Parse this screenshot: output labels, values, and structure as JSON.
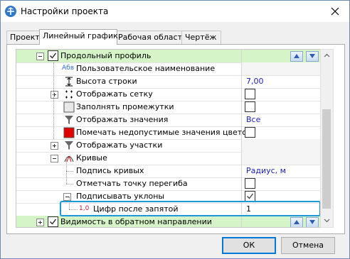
{
  "window": {
    "title": "Настройки проекта"
  },
  "tabs": [
    {
      "label": "Проект"
    },
    {
      "label": "Линейный график"
    },
    {
      "label": "Рабочая область"
    },
    {
      "label": "Чертёж"
    }
  ],
  "rows": [
    {
      "label": "Продольный профиль",
      "value": ""
    },
    {
      "label": "Пользовательское наименование",
      "value": ""
    },
    {
      "label": "Высота строки",
      "value": "7,00"
    },
    {
      "label": "Отображать сетку",
      "value": ""
    },
    {
      "label": "Заполнять промежутки",
      "value": ""
    },
    {
      "label": "Отображать значения",
      "value": "Все"
    },
    {
      "label": "Помечать недопустимые значения цветом",
      "value": ""
    },
    {
      "label": "Отображать участки",
      "value": ""
    },
    {
      "label": "Кривые",
      "value": ""
    },
    {
      "label": "Подпись кривых",
      "value": "Радиус, м"
    },
    {
      "label": "Отметчать точку перегиба",
      "value": ""
    },
    {
      "label": "Подписывать уклоны",
      "value": ""
    },
    {
      "label": "Цифр после запятой",
      "value": "1"
    },
    {
      "label": "Видимость в обратном направлении",
      "value": ""
    }
  ],
  "icons": {
    "abc": "Абв",
    "decimals": "1,0"
  },
  "colors": {
    "group_bg": "#d5f5c8",
    "value_text": "#1b1bb3",
    "red_swatch": "#e00000",
    "selection": "#1a9ad6"
  },
  "buttons": {
    "ok": "ОК",
    "cancel": "Отмена"
  }
}
